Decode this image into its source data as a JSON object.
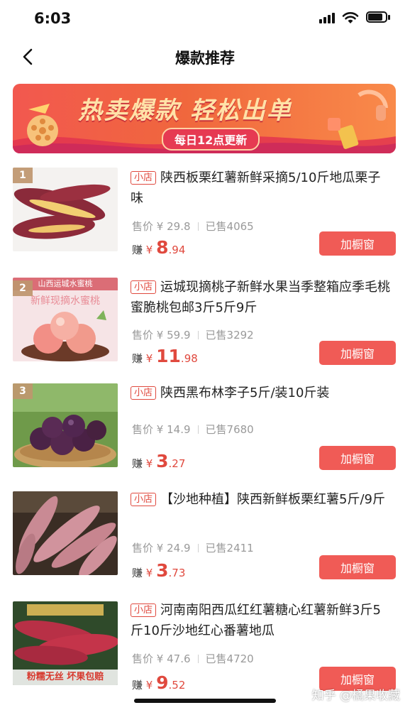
{
  "status_bar": {
    "time": "6:03"
  },
  "nav": {
    "title": "爆款推荐"
  },
  "banner": {
    "headline": "热卖爆款 轻松出单",
    "subline": "每日12点更新"
  },
  "labels": {
    "price_prefix": "售价",
    "sold_prefix": "已售",
    "earn_prefix": "赚",
    "currency": "¥",
    "shop_tag": "小店",
    "add_button": "加橱窗"
  },
  "products": [
    {
      "rank": "1",
      "title": "陕西板栗红薯新鲜采摘5/10斤地瓜栗子味",
      "price": "¥ 29.8",
      "sold": "4065",
      "earn_int": "8",
      "earn_dec": ".94",
      "thumb_top": "",
      "thumb_mid": "",
      "thumb_caption": ""
    },
    {
      "rank": "2",
      "title": "运城现摘桃子新鲜水果当季整箱应季毛桃蜜脆桃包邮3斤5斤9斤",
      "price": "¥ 59.9",
      "sold": "3292",
      "earn_int": "11",
      "earn_dec": ".98",
      "thumb_top": "山西运城水蜜桃",
      "thumb_mid": "新鲜现摘水蜜桃",
      "thumb_caption": ""
    },
    {
      "rank": "3",
      "title": "陕西黑布林李子5斤/装10斤装",
      "price": "¥ 14.9",
      "sold": "7680",
      "earn_int": "3",
      "earn_dec": ".27",
      "thumb_top": "",
      "thumb_mid": "",
      "thumb_caption": ""
    },
    {
      "rank": "",
      "title": "【沙地种植】陕西新鲜板栗红薯5斤/9斤",
      "price": "¥ 24.9",
      "sold": "2411",
      "earn_int": "3",
      "earn_dec": ".73",
      "thumb_top": "",
      "thumb_mid": "",
      "thumb_caption": ""
    },
    {
      "rank": "",
      "title": "河南南阳西瓜红红薯糖心红薯新鲜3斤5斤10斤沙地红心番薯地瓜",
      "price": "¥ 47.6",
      "sold": "4720",
      "earn_int": "9",
      "earn_dec": ".52",
      "thumb_top": "",
      "thumb_mid": "",
      "thumb_caption": "粉糯无丝 坏果包赔"
    }
  ],
  "watermark": "知乎 @橘果收藏",
  "colors": {
    "accent": "#f05b56",
    "earn": "#e0493e",
    "muted": "#9a9a9a"
  }
}
